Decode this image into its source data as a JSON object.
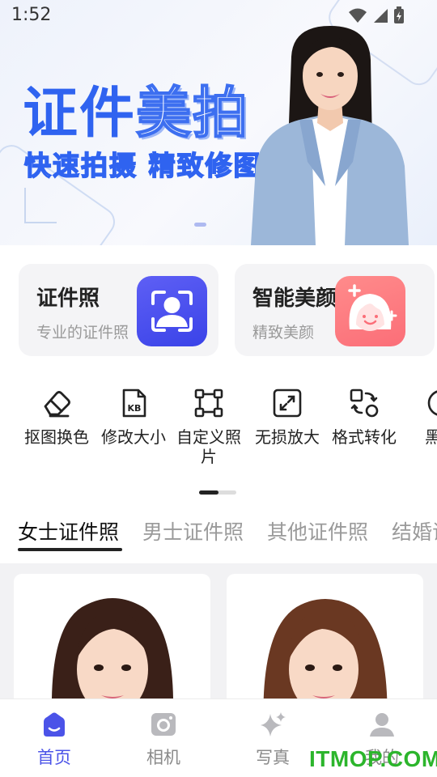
{
  "status_bar": {
    "time": "1:52"
  },
  "banner": {
    "title_part1": "证件",
    "title_part2": "美拍",
    "subtitle": "快速拍摄 精致修图"
  },
  "feature_cards": [
    {
      "title": "证件照",
      "subtitle": "专业的证件照",
      "icon": "portrait-frame-icon",
      "color": "#4b4ff0"
    },
    {
      "title": "智能美颜",
      "subtitle": "精致美颜",
      "icon": "beauty-face-icon",
      "color": "#fb7a80"
    }
  ],
  "tools": [
    {
      "label": "抠图换色",
      "icon": "eraser-icon"
    },
    {
      "label": "修改大小",
      "icon": "kb-file-icon"
    },
    {
      "label": "自定义照片",
      "icon": "crop-nodes-icon"
    },
    {
      "label": "无损放大",
      "icon": "expand-icon"
    },
    {
      "label": "格式转化",
      "icon": "convert-icon"
    },
    {
      "label": "黑白",
      "icon": "circle-icon"
    }
  ],
  "category_tabs": [
    {
      "label": "女士证件照",
      "active": true
    },
    {
      "label": "男士证件照",
      "active": false
    },
    {
      "label": "其他证件照",
      "active": false
    },
    {
      "label": "结婚证",
      "active": false
    }
  ],
  "bottom_nav": [
    {
      "label": "首页",
      "icon": "home-icon",
      "active": true
    },
    {
      "label": "相机",
      "icon": "camera-icon",
      "active": false
    },
    {
      "label": "写真",
      "icon": "sparkle-icon",
      "active": false
    },
    {
      "label": "我的",
      "icon": "profile-icon",
      "active": false
    }
  ],
  "watermark": "ITMOP.COM",
  "colors": {
    "accent": "#4b53e8",
    "banner_blue": "#2f63f0",
    "card_bg": "#f4f4f6"
  }
}
